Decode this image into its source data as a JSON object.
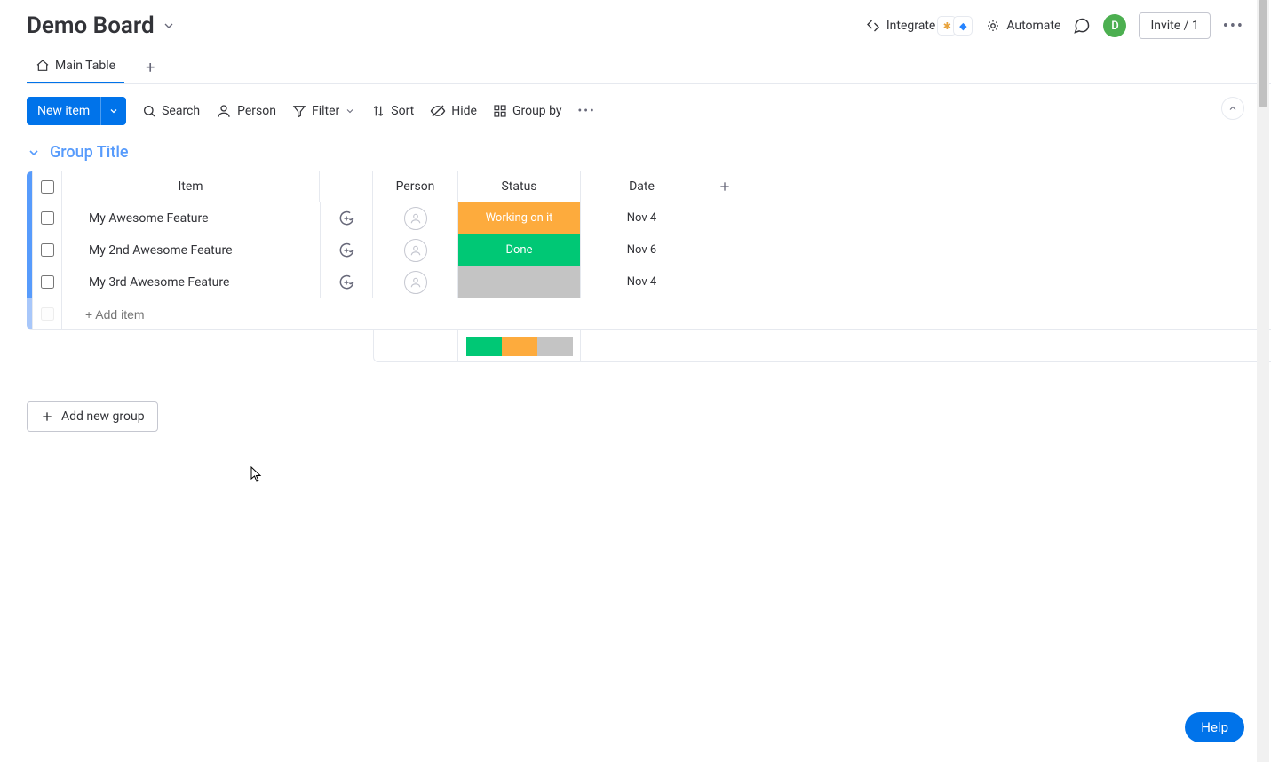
{
  "header": {
    "board_title": "Demo Board",
    "integrate_label": "Integrate",
    "automate_label": "Automate",
    "invite_label": "Invite / 1",
    "avatar_initial": "D"
  },
  "tabs": {
    "main_table": "Main Table"
  },
  "toolbar": {
    "new_item_label": "New item",
    "search_label": "Search",
    "person_label": "Person",
    "filter_label": "Filter",
    "sort_label": "Sort",
    "hide_label": "Hide",
    "group_by_label": "Group by"
  },
  "group": {
    "title": "Group Title",
    "columns": {
      "item": "Item",
      "person": "Person",
      "status": "Status",
      "date": "Date"
    },
    "rows": [
      {
        "name": "My Awesome Feature",
        "status_label": "Working on it",
        "status_color": "#fdab3d",
        "date": "Nov 4"
      },
      {
        "name": "My 2nd Awesome Feature",
        "status_label": "Done",
        "status_color": "#00c875",
        "date": "Nov 6"
      },
      {
        "name": "My 3rd Awesome Feature",
        "status_label": "",
        "status_color": "#c4c4c4",
        "date": "Nov 4"
      }
    ],
    "add_item_placeholder": "+ Add item",
    "summary_colors": [
      "#00c875",
      "#fdab3d",
      "#c4c4c4"
    ]
  },
  "add_group_label": "Add new group",
  "help_label": "Help"
}
